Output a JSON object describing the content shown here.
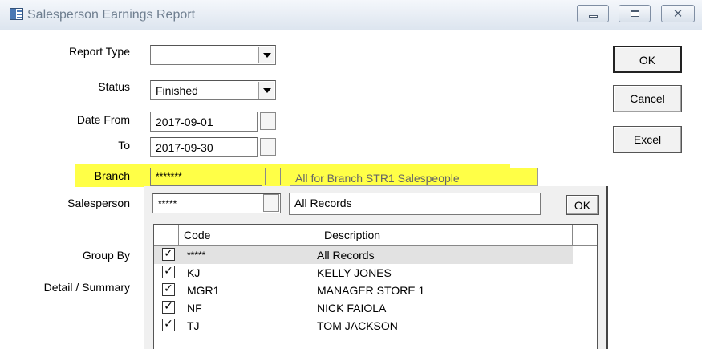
{
  "window": {
    "title": "Salesperson Earnings Report"
  },
  "form": {
    "report_type": {
      "label": "Report Type",
      "value": ""
    },
    "status": {
      "label": "Status",
      "value": "Finished"
    },
    "date_from": {
      "label": "Date From",
      "value": "2017-09-01"
    },
    "date_to": {
      "label": "To",
      "value": "2017-09-30"
    },
    "branch": {
      "label": "Branch",
      "code": "*******",
      "description": "All for Branch STR1 Salespeople"
    },
    "salesperson": {
      "label": "Salesperson",
      "code": "*****",
      "description": "All Records"
    },
    "group_by": {
      "label": "Group By"
    },
    "detail_summary": {
      "label": "Detail / Summary"
    }
  },
  "buttons": {
    "ok": "OK",
    "cancel": "Cancel",
    "excel": "Excel"
  },
  "lookup": {
    "ok_label": "OK",
    "columns": [
      "Code",
      "Description"
    ],
    "rows": [
      {
        "checked": true,
        "code": "*****",
        "description": "All Records"
      },
      {
        "checked": true,
        "code": "KJ",
        "description": "KELLY JONES"
      },
      {
        "checked": true,
        "code": "MGR1",
        "description": "MANAGER STORE 1"
      },
      {
        "checked": true,
        "code": "NF",
        "description": "NICK FAIOLA"
      },
      {
        "checked": true,
        "code": "TJ",
        "description": "TOM JACKSON"
      }
    ]
  },
  "colors": {
    "highlight": "#ffff47",
    "titlebar": "#dde5ef"
  }
}
